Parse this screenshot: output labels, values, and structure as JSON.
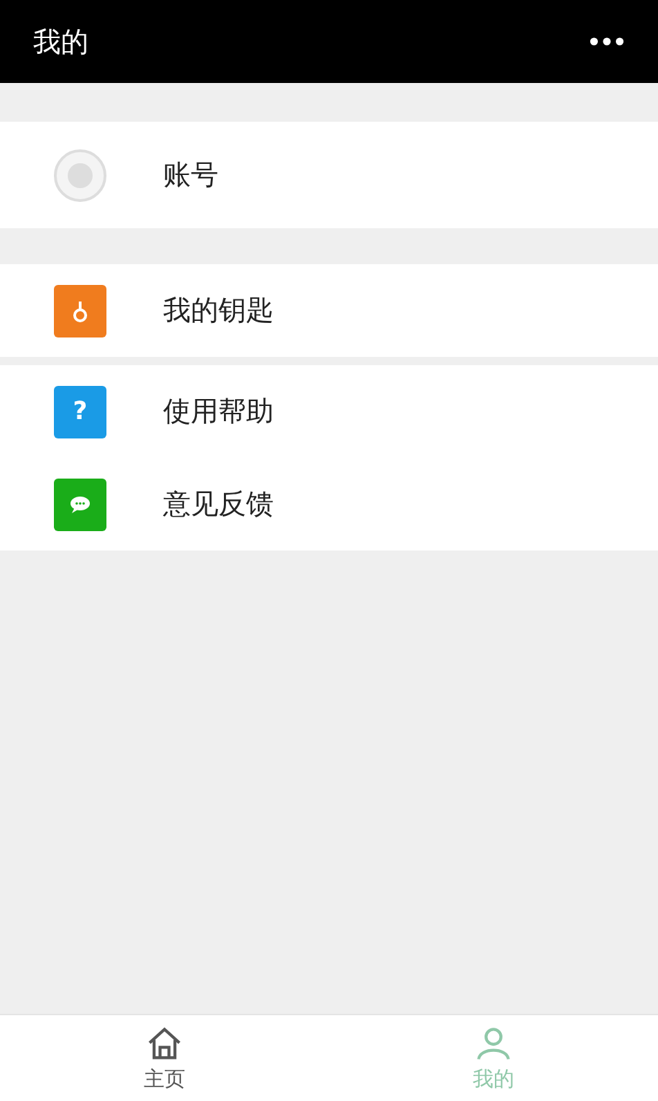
{
  "header": {
    "title": "我的"
  },
  "account": {
    "label": "账号"
  },
  "menu_groups": [
    [
      {
        "kind": "key",
        "label": "我的钥匙",
        "color": "#f07c1e"
      }
    ],
    [
      {
        "kind": "help",
        "glyph": "?",
        "label": "使用帮助",
        "color": "#1a9be6"
      },
      {
        "kind": "chat",
        "label": "意见反馈",
        "color": "#1aad19"
      }
    ]
  ],
  "tabs": [
    {
      "kind": "home",
      "label": "主页",
      "selected": false
    },
    {
      "kind": "person",
      "label": "我的",
      "selected": true
    }
  ]
}
